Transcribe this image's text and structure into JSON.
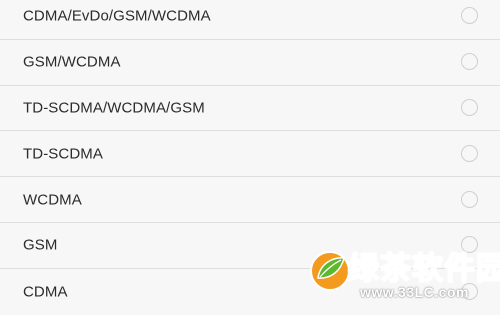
{
  "network_modes": [
    {
      "label": "CDMA/EvDo/GSM/WCDMA",
      "selected": false
    },
    {
      "label": "GSM/WCDMA",
      "selected": false
    },
    {
      "label": "TD-SCDMA/WCDMA/GSM",
      "selected": false
    },
    {
      "label": "TD-SCDMA",
      "selected": false
    },
    {
      "label": "WCDMA",
      "selected": false
    },
    {
      "label": "GSM",
      "selected": false
    },
    {
      "label": "CDMA",
      "selected": false
    }
  ],
  "watermark": {
    "title": "绿茶软件园",
    "url": "www.33LC.com"
  },
  "colors": {
    "background": "#f7f7f7",
    "divider": "#dedede",
    "radio_border": "#cfcfcf",
    "watermark_green": "#49a822",
    "watermark_orange": "#f39a1f"
  }
}
